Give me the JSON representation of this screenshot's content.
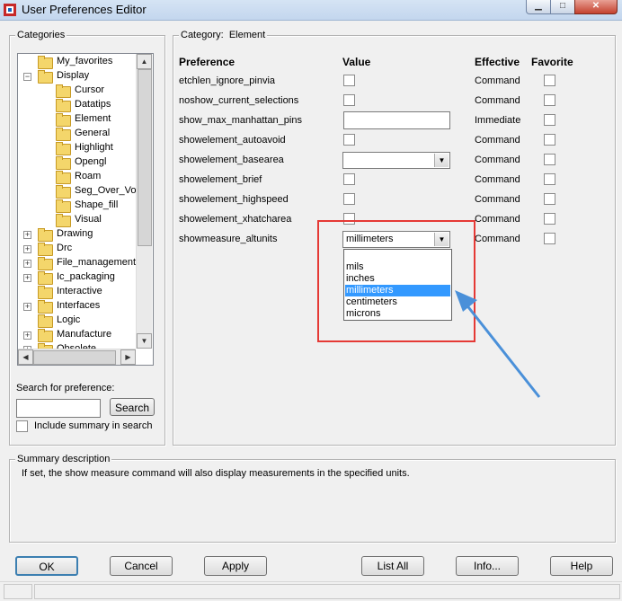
{
  "window": {
    "title": "User Preferences Editor"
  },
  "categories": {
    "label": "Categories",
    "tree": [
      {
        "label": "My_favorites",
        "level": 1,
        "expander": ""
      },
      {
        "label": "Display",
        "level": 1,
        "expander": "−"
      },
      {
        "label": "Cursor",
        "level": 2,
        "expander": ""
      },
      {
        "label": "Datatips",
        "level": 2,
        "expander": ""
      },
      {
        "label": "Element",
        "level": 2,
        "expander": ""
      },
      {
        "label": "General",
        "level": 2,
        "expander": ""
      },
      {
        "label": "Highlight",
        "level": 2,
        "expander": ""
      },
      {
        "label": "Opengl",
        "level": 2,
        "expander": ""
      },
      {
        "label": "Roam",
        "level": 2,
        "expander": ""
      },
      {
        "label": "Seg_Over_Voi",
        "level": 2,
        "expander": ""
      },
      {
        "label": "Shape_fill",
        "level": 2,
        "expander": ""
      },
      {
        "label": "Visual",
        "level": 2,
        "expander": ""
      },
      {
        "label": "Drawing",
        "level": 1,
        "expander": "+"
      },
      {
        "label": "Drc",
        "level": 1,
        "expander": "+"
      },
      {
        "label": "File_management",
        "level": 1,
        "expander": "+"
      },
      {
        "label": "Ic_packaging",
        "level": 1,
        "expander": "+"
      },
      {
        "label": "Interactive",
        "level": 1,
        "expander": ""
      },
      {
        "label": "Interfaces",
        "level": 1,
        "expander": "+"
      },
      {
        "label": "Logic",
        "level": 1,
        "expander": ""
      },
      {
        "label": "Manufacture",
        "level": 1,
        "expander": "+"
      },
      {
        "label": "Obsolete",
        "level": 1,
        "expander": "+"
      }
    ],
    "search_label": "Search for preference:",
    "search_value": "",
    "search_button": "Search",
    "include_summary_label": "Include summary in search"
  },
  "category_panel": {
    "label": "Category:",
    "value": "Element",
    "headers": {
      "preference": "Preference",
      "value": "Value",
      "effective": "Effective",
      "favorite": "Favorite"
    },
    "rows": [
      {
        "name": "etchlen_ignore_pinvia",
        "control": "checkbox",
        "effective": "Command"
      },
      {
        "name": "noshow_current_selections",
        "control": "checkbox",
        "effective": "Command"
      },
      {
        "name": "show_max_manhattan_pins",
        "control": "text",
        "value": "",
        "effective": "Immediate"
      },
      {
        "name": "showelement_autoavoid",
        "control": "checkbox",
        "effective": "Command"
      },
      {
        "name": "showelement_basearea",
        "control": "combo",
        "value": "",
        "effective": "Command"
      },
      {
        "name": "showelement_brief",
        "control": "checkbox",
        "effective": "Command"
      },
      {
        "name": "showelement_highspeed",
        "control": "checkbox",
        "effective": "Command"
      },
      {
        "name": "showelement_xhatcharea",
        "control": "checkbox",
        "effective": "Command"
      },
      {
        "name": "showmeasure_altunits",
        "control": "combo",
        "value": "millimeters",
        "effective": "Command"
      }
    ],
    "dropdown": {
      "options": [
        "",
        "mils",
        "inches",
        "millimeters",
        "centimeters",
        "microns"
      ],
      "selected": "millimeters"
    }
  },
  "summary": {
    "label": "Summary description",
    "text": "If set, the show measure command will also display measurements in the specified units."
  },
  "buttons": {
    "ok": "OK",
    "cancel": "Cancel",
    "apply": "Apply",
    "list_all": "List All",
    "info": "Info...",
    "help": "Help"
  },
  "annotation": {
    "highlight_color": "#e53935",
    "arrow_color": "#4a90d9"
  }
}
